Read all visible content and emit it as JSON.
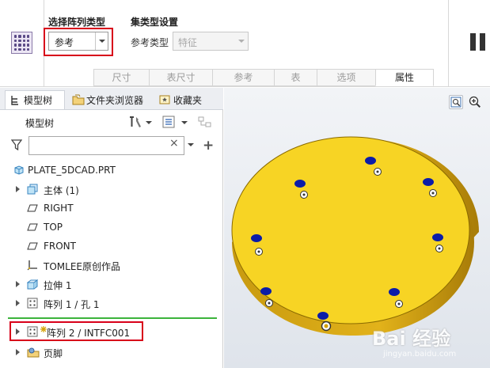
{
  "ribbon": {
    "pattern_type_label": "选择阵列类型",
    "pattern_type_value": "参考",
    "set_type_label": "集类型设置",
    "ref_type_label": "参考类型",
    "ref_type_value": "特征",
    "tabs": [
      "尺寸",
      "表尺寸",
      "参考",
      "表",
      "选项",
      "属性"
    ],
    "active_tab": "属性"
  },
  "panel": {
    "tabs": [
      "模型树",
      "文件夹浏览器",
      "收藏夹"
    ],
    "tree_title": "模型树",
    "search_placeholder": "",
    "search_clear": "×",
    "search_add": "+",
    "tree": [
      {
        "label": "PLATE_5DCAD.PRT",
        "expandable": false,
        "icon": "part-icon"
      },
      {
        "label": "主体 (1)",
        "expandable": true,
        "icon": "body-icon"
      },
      {
        "label": "RIGHT",
        "expandable": false,
        "icon": "datum-plane-icon"
      },
      {
        "label": "TOP",
        "expandable": false,
        "icon": "datum-plane-icon"
      },
      {
        "label": "FRONT",
        "expandable": false,
        "icon": "datum-plane-icon"
      },
      {
        "label": "TOMLEE原创作品",
        "expandable": false,
        "icon": "coordinate-system-icon"
      },
      {
        "label": "拉伸 1",
        "expandable": true,
        "icon": "extrude-icon"
      },
      {
        "label": "阵列 1 / 孔 1",
        "expandable": true,
        "icon": "pattern-icon"
      },
      {
        "label": "阵列 2 / INTFC001",
        "expandable": true,
        "icon": "pattern-icon",
        "highlighted": true
      },
      {
        "label": "页脚",
        "expandable": true,
        "icon": "footer-icon"
      }
    ]
  },
  "viewport": {
    "part_color": "#f5d21f",
    "hole_color": "#0a1aa8"
  },
  "watermark": {
    "brand": "Bai  经验",
    "sub": "jingyan.baidu.com"
  }
}
